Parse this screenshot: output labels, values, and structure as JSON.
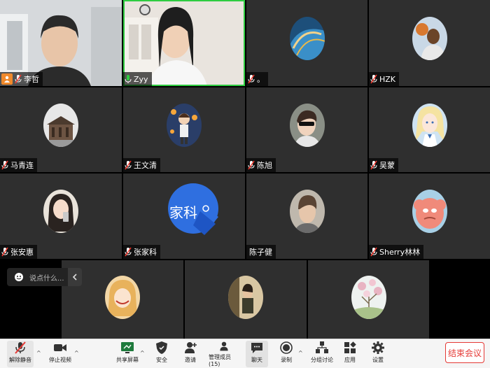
{
  "participants": [
    {
      "name": "李哲"
    },
    {
      "name": "Zyy"
    },
    {
      "name": "。"
    },
    {
      "name": "HZK"
    },
    {
      "name": "马青连"
    },
    {
      "name": "王文清"
    },
    {
      "name": "陈旭"
    },
    {
      "name": "吴蒙"
    },
    {
      "name": "张安惠"
    },
    {
      "name": "张家科",
      "avatar_text": "家科"
    },
    {
      "name": "陈子健"
    },
    {
      "name": "Sherry林林"
    }
  ],
  "chat": {
    "placeholder": "说点什么..."
  },
  "toolbar": {
    "unmute": "解除静音",
    "stop_video": "停止视频",
    "share_screen": "共享屏幕",
    "security": "安全",
    "invite": "邀请",
    "manage_members": "管理成员(15)",
    "chat": "聊天",
    "record": "录制",
    "breakout": "分组讨论",
    "apps": "应用",
    "settings": "设置",
    "end_meeting": "结束会议"
  },
  "colors": {
    "active_speaker": "#2ecc40",
    "end_button": "#e53935",
    "host_badge": "#f0892b"
  }
}
